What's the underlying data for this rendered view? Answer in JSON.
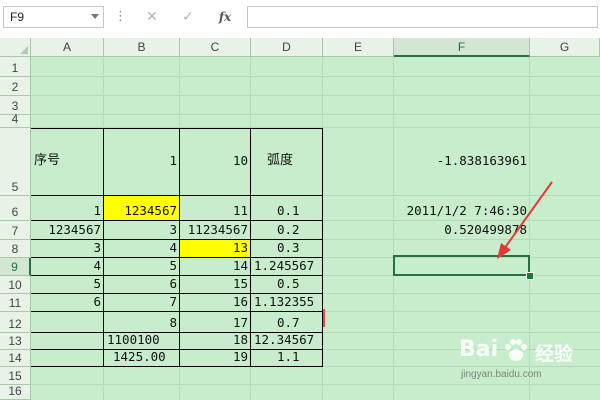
{
  "formula_bar": {
    "name_box": "F9",
    "separator": "⋮",
    "cancel_icon": "close-icon",
    "enter_icon": "check-icon",
    "fx_label": "fx",
    "formula": ""
  },
  "columns": [
    "A",
    "B",
    "C",
    "D",
    "E",
    "F",
    "G"
  ],
  "rows": [
    "1",
    "2",
    "3",
    "4",
    "5",
    "6",
    "7",
    "8",
    "9",
    "10",
    "11",
    "12",
    "13",
    "14",
    "15",
    "16"
  ],
  "selected_cell": "F9",
  "cells": {
    "a5": "序号",
    "b5": "1",
    "c5": "10",
    "d5": "弧度",
    "f5": "-1.838163961",
    "a6": "1",
    "b6": "1234567",
    "c6": "11",
    "d6": "0.1",
    "f6": "2011/1/2 7:46:30",
    "a7": "1234567",
    "b7": "3",
    "c7": "11234567",
    "d7": "0.2",
    "f7": "0.520499878",
    "a8": "3",
    "b8": "4",
    "c8": "13",
    "d8": "0.3",
    "a9": "4",
    "b9": "5",
    "c9": "14",
    "d9": "1.245567",
    "a10": "5",
    "b10": "6",
    "c10": "15",
    "d10": "0.5",
    "a11": "6",
    "b11": "7",
    "c11": "16",
    "d11": "1.132355",
    "b12": "8",
    "c12": "17",
    "d12": "0.7",
    "b13": "1100100",
    "c13": "18",
    "d13": "12.34567",
    "b14": "1425.00",
    "c14": "19",
    "d14": "1.1"
  },
  "highlight_color": "#ffff00",
  "selection_color": "#217346",
  "grid_background": "#c7edcc",
  "arrow_color": "#e53935",
  "watermark": {
    "brand": "Bai",
    "suffix": "经验",
    "url": "jingyan.baidu.com"
  }
}
